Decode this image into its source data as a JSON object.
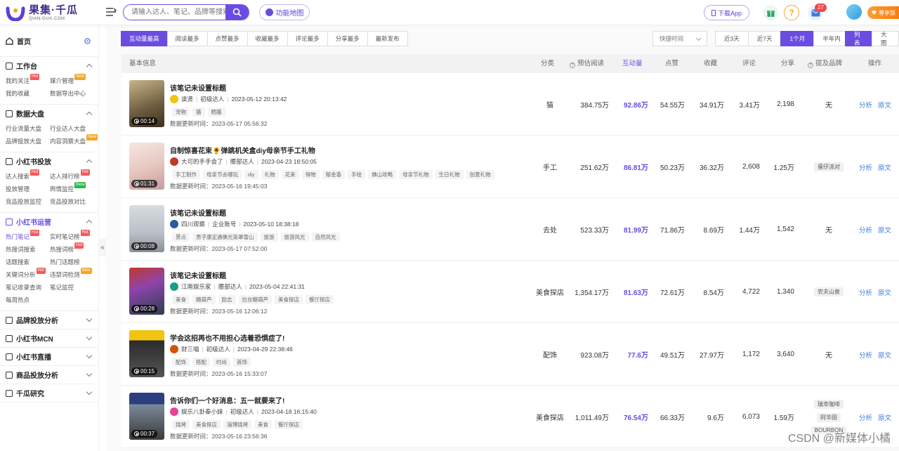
{
  "header": {
    "logo_name": "果集·千瓜",
    "logo_sub": "QIAN-GUA.COM",
    "search_placeholder": "请输入达人、笔记、品牌等搜索",
    "func_map": "功能地图",
    "download_app": "下载App",
    "message_badge": "27",
    "vip_label": "尊享版"
  },
  "sidebar": {
    "home": "首页",
    "sections": [
      {
        "title": "工作台",
        "expanded": true,
        "items": [
          {
            "label": "我的关注",
            "tag": "Hot"
          },
          {
            "label": "媒介管理",
            "tag": "New"
          },
          {
            "label": "我的收藏",
            "tag": ""
          },
          {
            "label": "数据导出中心",
            "tag": ""
          }
        ]
      },
      {
        "title": "数据大盘",
        "expanded": true,
        "items": [
          {
            "label": "行业流量大盘",
            "tag": ""
          },
          {
            "label": "行业达人大盘",
            "tag": ""
          },
          {
            "label": "品牌投放大盘",
            "tag": ""
          },
          {
            "label": "内容洞察大盘",
            "tag": "New"
          }
        ]
      },
      {
        "title": "小红书投放",
        "expanded": true,
        "items": [
          {
            "label": "达人搜索",
            "tag": "Hot"
          },
          {
            "label": "达人排行榜",
            "tag": "Hot"
          },
          {
            "label": "投放管理",
            "tag": ""
          },
          {
            "label": "舆情监控",
            "tag": "Beta"
          },
          {
            "label": "竞品投放监控",
            "tag": ""
          },
          {
            "label": "竞品投放对比",
            "tag": ""
          }
        ]
      },
      {
        "title": "小红书运营",
        "expanded": true,
        "active": true,
        "items": [
          {
            "label": "热门笔记",
            "tag": "Hot",
            "active": true
          },
          {
            "label": "实时笔记榜",
            "tag": "Hot"
          },
          {
            "label": "热搜词搜索",
            "tag": ""
          },
          {
            "label": "热搜词榜",
            "tag": "Hot"
          },
          {
            "label": "话题搜索",
            "tag": ""
          },
          {
            "label": "热门话题榜",
            "tag": ""
          },
          {
            "label": "关键词分析",
            "tag": "Hot"
          },
          {
            "label": "违禁词检测",
            "tag": "New"
          },
          {
            "label": "笔记收录查询",
            "tag": ""
          },
          {
            "label": "笔记监控",
            "tag": ""
          },
          {
            "label": "每周热点",
            "tag": ""
          }
        ]
      },
      {
        "title": "品牌投放分析",
        "expanded": false,
        "items": []
      },
      {
        "title": "小红书MCN",
        "expanded": false,
        "items": []
      },
      {
        "title": "小红书直播",
        "expanded": false,
        "items": []
      },
      {
        "title": "商品投放分析",
        "expanded": false,
        "items": []
      },
      {
        "title": "千瓜研究",
        "expanded": false,
        "items": []
      }
    ]
  },
  "filters": {
    "sort_tabs": [
      "互动量最高",
      "阅读最多",
      "点赞最多",
      "收藏最多",
      "评论最多",
      "分享最多",
      "最新发布"
    ],
    "quick_time": "快捷时间",
    "ranges": [
      "近3天",
      "近7天",
      "1个月",
      "半年内"
    ],
    "active_range": "1个月",
    "views": [
      "列表",
      "大图"
    ]
  },
  "table": {
    "headers": {
      "basic": "基本信息",
      "category": "分类",
      "est_read": "预估阅读",
      "interact": "互动量",
      "likes": "点赞",
      "collect": "收藏",
      "comment": "评论",
      "share": "分享",
      "brand": "提及品牌",
      "ops": "操作"
    },
    "op_analyze": "分析",
    "op_original": "原文",
    "update_prefix": "数据更新时间：",
    "rows": [
      {
        "title": "该笔记未设置标题",
        "author": "诶贤",
        "level": "初级达人",
        "time": "2023-05-12 20:13:42",
        "tags": [
          "宠物",
          "猫",
          "晒猫"
        ],
        "updated": "2023-05-17 05:56:32",
        "duration": "00:14",
        "category": "猫",
        "est_read": "384.75万",
        "interact": "92.86万",
        "likes": "54.55万",
        "collect": "34.91万",
        "comment": "3.41万",
        "share": "2,198",
        "brands": [
          "无"
        ]
      },
      {
        "title": "自制惊喜花束🌻弹跳机关盒diy母亲节手工礼物",
        "author": "大可的手手会了",
        "level": "腰部达人",
        "time": "2023-04-23 18:50:05",
        "tags": [
          "手工制作",
          "母亲节去哪玩",
          "diy",
          "礼物",
          "花束",
          "得物",
          "郁金香",
          "手绘",
          "佛山攻略",
          "母亲节礼物",
          "生日礼物",
          "创意礼物"
        ],
        "updated": "2023-05-16 19:45:03",
        "duration": "01:31",
        "category": "手工",
        "est_read": "251.62万",
        "interact": "86.81万",
        "likes": "50.23万",
        "collect": "36.32万",
        "comment": "2,608",
        "share": "1.25万",
        "brands": [
          "蛋仔派对"
        ]
      },
      {
        "title": "该笔记未设置标题",
        "author": "四川观察",
        "level": "企业账号",
        "time": "2023-05-10 18:38:18",
        "tags": [
          "景点",
          "男子康定遇佛光笼罩雪山",
          "旅游",
          "旅游风光",
          "自然风光"
        ],
        "updated": "2023-05-17 07:52:00",
        "duration": "00:08",
        "category": "去处",
        "est_read": "523.33万",
        "interact": "81.99万",
        "likes": "71.86万",
        "collect": "8.69万",
        "comment": "1.44万",
        "share": "1,542",
        "brands": [
          "无"
        ]
      },
      {
        "title": "该笔记未设置标题",
        "author": "江南娱乐家",
        "level": "腰部达人",
        "time": "2023-05-04 22:41:31",
        "tags": [
          "美食",
          "糖葫芦",
          "励志",
          "拉丝糖葫芦",
          "美食探店",
          "餐厅探店"
        ],
        "updated": "2023-05-16 12:06:12",
        "duration": "00:28",
        "category": "美食探店",
        "est_read": "1,354.17万",
        "interact": "81.63万",
        "likes": "72.61万",
        "collect": "8.54万",
        "comment": "4,722",
        "share": "1,340",
        "brands": [
          "农夫山泉"
        ]
      },
      {
        "title": "学会这招再也不用担心选着恐惧症了!",
        "author": "财三喵",
        "level": "初级达人",
        "time": "2023-04-29 22:38:46",
        "tags": [
          "配饰",
          "搭配",
          "时尚",
          "首饰"
        ],
        "updated": "2023-05-16 15:33:07",
        "duration": "00:15",
        "category": "配饰",
        "est_read": "923.08万",
        "interact": "77.6万",
        "likes": "49.51万",
        "collect": "27.97万",
        "comment": "1,172",
        "share": "3,640",
        "brands": [
          "无"
        ]
      },
      {
        "title": "告诉你们一个好消息：五一就要来了!",
        "author": "娱乐八卦秦小妹",
        "level": "初级达人",
        "time": "2023-04-18 16:15:40",
        "tags": [
          "烧烤",
          "美食探店",
          "淄博烧烤",
          "美食",
          "餐厅探店"
        ],
        "updated": "2023-05-16 23:56:36",
        "duration": "00:37",
        "category": "美食探店",
        "est_read": "1,011.49万",
        "interact": "76.54万",
        "likes": "66.33万",
        "collect": "9.6万",
        "comment": "6,073",
        "share": "1.59万",
        "brands": [
          "瑞幸咖啡",
          "阿华田",
          "BOURBON"
        ]
      }
    ]
  },
  "watermark": "CSDN @新媒体小橘",
  "colors": {
    "accent": "#6a4de0",
    "link": "#3b7ee0",
    "hot": "#f25b5b",
    "new": "#f5a623",
    "beta": "#2db84d"
  }
}
